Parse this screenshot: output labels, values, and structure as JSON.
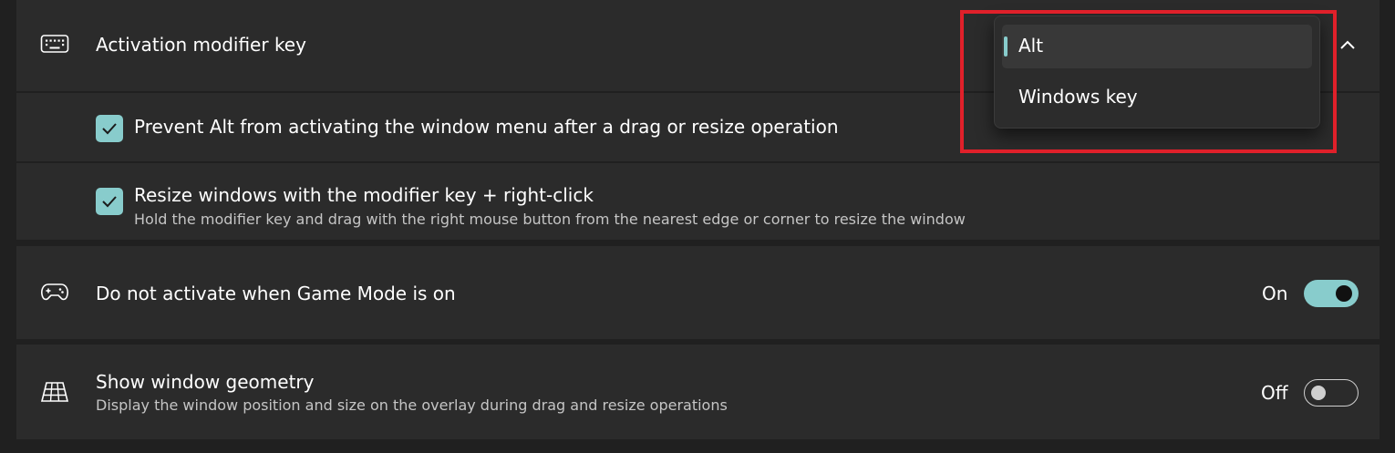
{
  "activation": {
    "label": "Activation modifier key",
    "icon": "keyboard-icon",
    "dropdown_options": [
      {
        "label": "Alt",
        "selected": true
      },
      {
        "label": "Windows key",
        "selected": false
      }
    ]
  },
  "prevent_alt": {
    "label": "Prevent Alt from activating the window menu after a drag or resize operation",
    "checked": true
  },
  "resize_rightclick": {
    "label": "Resize windows with the modifier key + right-click",
    "description": "Hold the modifier key and drag with the right mouse button from the nearest edge or corner to resize the window",
    "checked": true
  },
  "game_mode": {
    "label": "Do not activate when Game Mode is on",
    "icon": "gamepad-icon",
    "state_text": "On",
    "on": true
  },
  "geometry": {
    "label": "Show window geometry",
    "description": "Display the window position and size on the overlay during drag and resize operations",
    "icon": "grid-icon",
    "state_text": "Off",
    "on": false
  },
  "colors": {
    "accent": "#88cccc",
    "card": "#2b2b2b",
    "background": "#202020",
    "highlight": "#e0202a"
  }
}
